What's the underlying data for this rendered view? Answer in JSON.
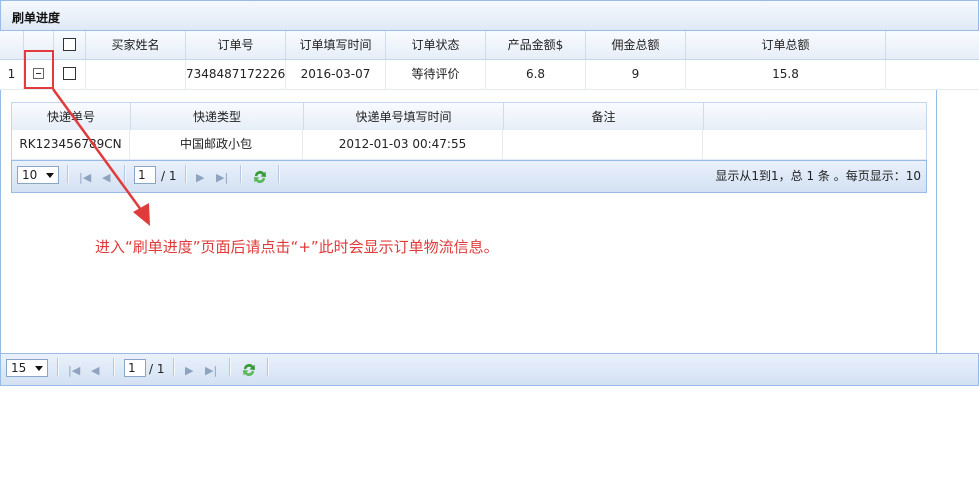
{
  "panel": {
    "title": "刷单进度"
  },
  "grid": {
    "headers": [
      "",
      "",
      "",
      "买家姓名",
      "订单号",
      "订单填写时间",
      "订单状态",
      "产品金额$",
      "佣金总额",
      "订单总额"
    ],
    "row": {
      "index": "1",
      "buyer_name": "",
      "order_no": "7348487172226",
      "order_time": "2016-03-07",
      "status": "等待评价",
      "product_amount": "6.8",
      "commission": "9",
      "total": "15.8"
    }
  },
  "detail": {
    "headers": [
      "快递单号",
      "快递类型",
      "快递单号填写时间",
      "备注"
    ],
    "row": {
      "tracking_no": "RK123456789CN",
      "courier": "中国邮政小包",
      "fill_time": "2012-01-03 00:47:55",
      "remark": ""
    },
    "pager": {
      "page_size": "10",
      "page": "1",
      "total_pages": "/ 1",
      "summary": "显示从1到1，总 1 条 。每页显示：10"
    }
  },
  "main_pager": {
    "page_size": "15",
    "page": "1",
    "total_pages": "/ 1"
  },
  "annotation": "进入“刷单进度”页面后请点击“+”此时会显示订单物流信息。",
  "colors": {
    "accent_red": "#e03b3b",
    "border_blue": "#99bbe8",
    "refresh_green": "#3a9a3a"
  }
}
